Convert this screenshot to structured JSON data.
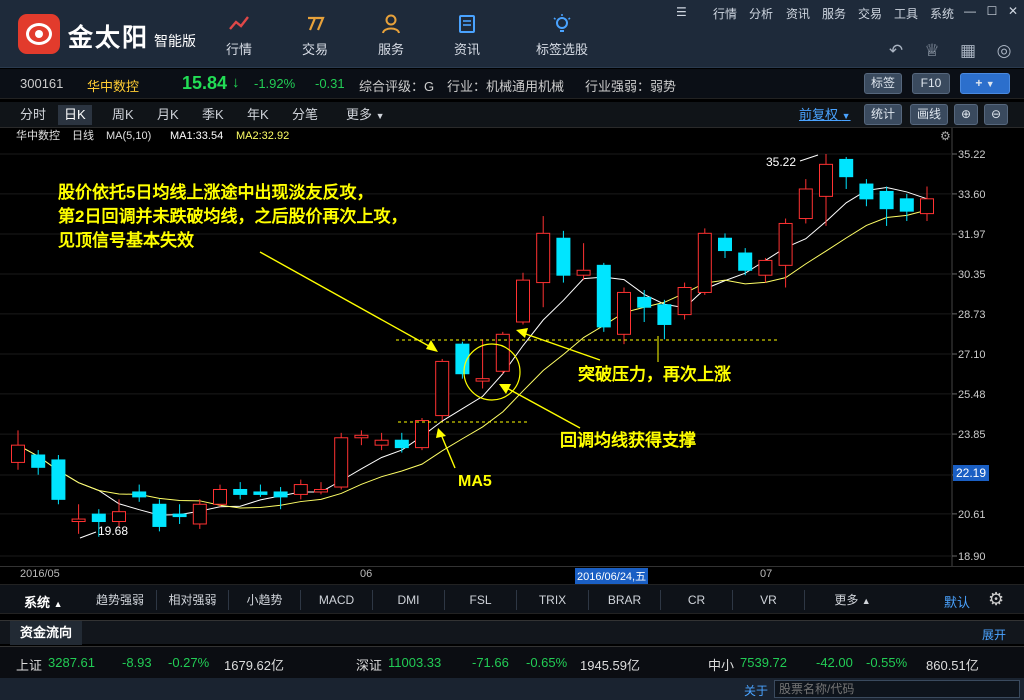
{
  "app": {
    "brand": "金太阳",
    "brand_sub": "智能版"
  },
  "nav": [
    {
      "label": "行情",
      "icon": "chart-line-icon"
    },
    {
      "label": "交易",
      "icon": "trade-icon"
    },
    {
      "label": "服务",
      "icon": "user-icon"
    },
    {
      "label": "资讯",
      "icon": "news-icon"
    },
    {
      "label": "标签选股",
      "icon": "bulb-icon"
    }
  ],
  "menu": [
    "行情",
    "分析",
    "资讯",
    "服务",
    "交易",
    "工具",
    "系统"
  ],
  "quote": {
    "code": "300161",
    "name": "华中数控",
    "price": "15.84",
    "arrow": "↓",
    "change_pct": "-1.92%",
    "change": "-0.31",
    "rating": "综合评级：G",
    "industry": "行业：机械通用机械",
    "strength": "行业强弱：弱势",
    "btn_tag": "标签",
    "btn_f10": "F10",
    "btn_plus": "+"
  },
  "tabs": [
    "分时",
    "日K",
    "周K",
    "月K",
    "季K",
    "年K",
    "分笔",
    "更多"
  ],
  "tab_right": {
    "fuquan": "前复权",
    "stats": "统计",
    "draw": "画线"
  },
  "legend": {
    "name": "华中数控",
    "period": "日线",
    "ma": "MA(5,10)",
    "ma1": "MA1:33.54",
    "ma2": "MA2:32.92"
  },
  "chart_data": {
    "type": "candlestick",
    "y_ticks": [
      "35.22",
      "33.60",
      "31.97",
      "30.35",
      "28.73",
      "27.10",
      "25.48",
      "23.85",
      "22.19",
      "20.61",
      "18.90"
    ],
    "ylim": [
      18.9,
      35.22
    ],
    "current_price": "22.19",
    "high_label": "35.22",
    "low_label": "19.68",
    "colors": {
      "up": "#ff3232",
      "down": "#00e5ff",
      "ma5": "#ffffff",
      "ma10": "#ffff66"
    },
    "candles": [
      {
        "o": 22.7,
        "c": 23.4,
        "h": 24.0,
        "l": 22.4
      },
      {
        "o": 23.0,
        "c": 22.5,
        "h": 23.2,
        "l": 22.2
      },
      {
        "o": 22.8,
        "c": 21.2,
        "h": 23.0,
        "l": 21.0
      },
      {
        "o": 20.3,
        "c": 20.4,
        "h": 21.0,
        "l": 19.8
      },
      {
        "o": 20.6,
        "c": 20.3,
        "h": 20.8,
        "l": 19.68
      },
      {
        "o": 20.3,
        "c": 20.7,
        "h": 21.2,
        "l": 20.1
      },
      {
        "o": 21.5,
        "c": 21.3,
        "h": 21.8,
        "l": 21.1
      },
      {
        "o": 21.0,
        "c": 20.1,
        "h": 21.2,
        "l": 19.9
      },
      {
        "o": 20.6,
        "c": 20.5,
        "h": 21.0,
        "l": 20.2
      },
      {
        "o": 20.2,
        "c": 21.0,
        "h": 21.2,
        "l": 20.0
      },
      {
        "o": 21.0,
        "c": 21.6,
        "h": 21.8,
        "l": 20.9
      },
      {
        "o": 21.6,
        "c": 21.4,
        "h": 21.9,
        "l": 21.2
      },
      {
        "o": 21.5,
        "c": 21.4,
        "h": 21.8,
        "l": 21.3
      },
      {
        "o": 21.5,
        "c": 21.3,
        "h": 21.7,
        "l": 20.8
      },
      {
        "o": 21.4,
        "c": 21.8,
        "h": 22.0,
        "l": 21.2
      },
      {
        "o": 21.5,
        "c": 21.6,
        "h": 21.9,
        "l": 21.4
      },
      {
        "o": 21.7,
        "c": 23.7,
        "h": 23.9,
        "l": 21.6
      },
      {
        "o": 23.7,
        "c": 23.8,
        "h": 24.0,
        "l": 23.4
      },
      {
        "o": 23.4,
        "c": 23.6,
        "h": 23.9,
        "l": 23.2
      },
      {
        "o": 23.6,
        "c": 23.3,
        "h": 23.9,
        "l": 23.1
      },
      {
        "o": 23.3,
        "c": 24.4,
        "h": 24.5,
        "l": 23.2
      },
      {
        "o": 24.6,
        "c": 26.8,
        "h": 26.9,
        "l": 24.4
      },
      {
        "o": 27.5,
        "c": 26.3,
        "h": 27.6,
        "l": 26.1
      },
      {
        "o": 26.0,
        "c": 26.1,
        "h": 27.7,
        "l": 25.7
      },
      {
        "o": 26.4,
        "c": 27.9,
        "h": 28.0,
        "l": 26.3
      },
      {
        "o": 28.4,
        "c": 30.1,
        "h": 30.4,
        "l": 28.3
      },
      {
        "o": 30.0,
        "c": 32.0,
        "h": 32.7,
        "l": 29.0
      },
      {
        "o": 31.8,
        "c": 30.3,
        "h": 32.1,
        "l": 30.0
      },
      {
        "o": 30.3,
        "c": 30.5,
        "h": 31.6,
        "l": 30.1
      },
      {
        "o": 30.7,
        "c": 28.2,
        "h": 30.8,
        "l": 28.0
      },
      {
        "o": 27.9,
        "c": 29.6,
        "h": 29.8,
        "l": 27.5
      },
      {
        "o": 29.4,
        "c": 29.0,
        "h": 29.7,
        "l": 28.4
      },
      {
        "o": 29.1,
        "c": 28.3,
        "h": 29.3,
        "l": 27.7
      },
      {
        "o": 28.7,
        "c": 29.8,
        "h": 30.0,
        "l": 28.5
      },
      {
        "o": 29.6,
        "c": 32.0,
        "h": 32.2,
        "l": 29.5
      },
      {
        "o": 31.8,
        "c": 31.3,
        "h": 32.0,
        "l": 31.0
      },
      {
        "o": 31.2,
        "c": 30.5,
        "h": 31.4,
        "l": 30.3
      },
      {
        "o": 30.3,
        "c": 30.9,
        "h": 31.0,
        "l": 30.0
      },
      {
        "o": 30.7,
        "c": 32.4,
        "h": 32.6,
        "l": 29.8
      },
      {
        "o": 32.6,
        "c": 33.8,
        "h": 34.2,
        "l": 32.4
      },
      {
        "o": 33.5,
        "c": 34.8,
        "h": 35.22,
        "l": 32.3
      },
      {
        "o": 35.0,
        "c": 34.3,
        "h": 35.1,
        "l": 33.8
      },
      {
        "o": 34.0,
        "c": 33.4,
        "h": 34.2,
        "l": 33.1
      },
      {
        "o": 33.7,
        "c": 33.0,
        "h": 33.9,
        "l": 32.3
      },
      {
        "o": 33.4,
        "c": 32.9,
        "h": 33.6,
        "l": 32.5
      },
      {
        "o": 32.8,
        "c": 33.4,
        "h": 33.9,
        "l": 32.5
      }
    ]
  },
  "annotations": {
    "main_text": [
      "股价依托5日均线上涨途中出现淡友反攻，",
      "第2日回调并未跌破均线，之后股价再次上攻，",
      "见顶信号基本失效"
    ],
    "breakout": "突破压力，再次上涨",
    "support": "回调均线获得支撑",
    "ma5": "MA5"
  },
  "dates": {
    "d1": "2016/05",
    "d2": "06",
    "d3": "2016/06/24,五",
    "d4": "07"
  },
  "indicators": {
    "system": "系统",
    "items": [
      "趋势强弱",
      "相对强弱",
      "小趋势",
      "MACD",
      "DMI",
      "FSL",
      "TRIX",
      "BRAR",
      "CR",
      "VR",
      "更多"
    ],
    "default": "默认"
  },
  "flow": {
    "title": "资金流向",
    "expand": "展开"
  },
  "footer": {
    "sh": {
      "name": "上证",
      "value": "3287.61",
      "change": "-8.93",
      "pct": "-0.27%",
      "amount": "1679.62亿"
    },
    "sz": {
      "name": "深证",
      "value": "11003.33",
      "change": "-71.66",
      "pct": "-0.65%",
      "amount": "1945.59亿"
    },
    "zx": {
      "name": "中小",
      "value": "7539.72",
      "change": "-42.00",
      "pct": "-0.55%",
      "amount": "860.51亿"
    }
  },
  "status": {
    "focus": "关于",
    "search_placeholder": "股票名称/代码"
  }
}
